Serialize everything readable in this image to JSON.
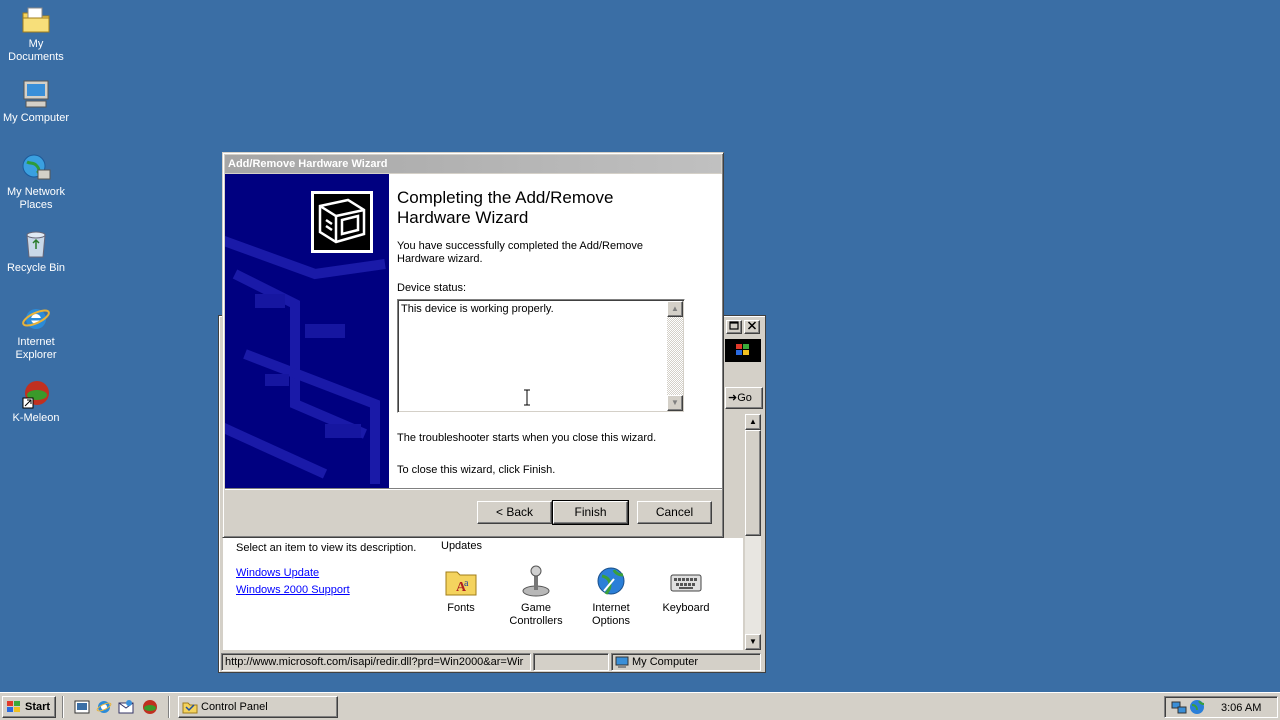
{
  "desktop": {
    "icons": [
      {
        "label": "My Documents"
      },
      {
        "label": "My Computer"
      },
      {
        "label": "My Network Places"
      },
      {
        "label": "Recycle Bin"
      },
      {
        "label": "Internet Explorer"
      },
      {
        "label": "K-Meleon"
      }
    ]
  },
  "wizard": {
    "title": "Add/Remove Hardware Wizard",
    "heading": "Completing the Add/Remove Hardware Wizard",
    "success_text": "You have successfully completed the Add/Remove Hardware wizard.",
    "device_status_label": "Device status:",
    "device_status_value": "This device is working properly.",
    "troubleshooter_text": "The troubleshooter starts when you close this wizard.",
    "close_text": "To close this wizard, click Finish.",
    "back_label": "< Back",
    "finish_label": "Finish",
    "cancel_label": "Cancel"
  },
  "control_panel": {
    "go_label": "Go",
    "description_text": "Select an item to view its description.",
    "links": [
      "Windows Update",
      "Windows 2000 Support"
    ],
    "partial_label": "Updates",
    "items": [
      {
        "label": "Fonts",
        "icon": "fonts-folder-icon"
      },
      {
        "label": "Game Controllers",
        "icon": "joystick-icon"
      },
      {
        "label": "Internet Options",
        "icon": "globe-icon"
      },
      {
        "label": "Keyboard",
        "icon": "keyboard-icon"
      }
    ],
    "status_url": "http://www.microsoft.com/isapi/redir.dll?prd=Win2000&ar=Wir",
    "status_zone": "My Computer"
  },
  "taskbar": {
    "start_label": "Start",
    "task_label": "Control Panel",
    "clock": "3:06 AM"
  },
  "colors": {
    "desktop": "#3a6ea5",
    "wizard_side": "#000080",
    "title_inactive": "#a6a6a6",
    "link": "#0000ff"
  }
}
